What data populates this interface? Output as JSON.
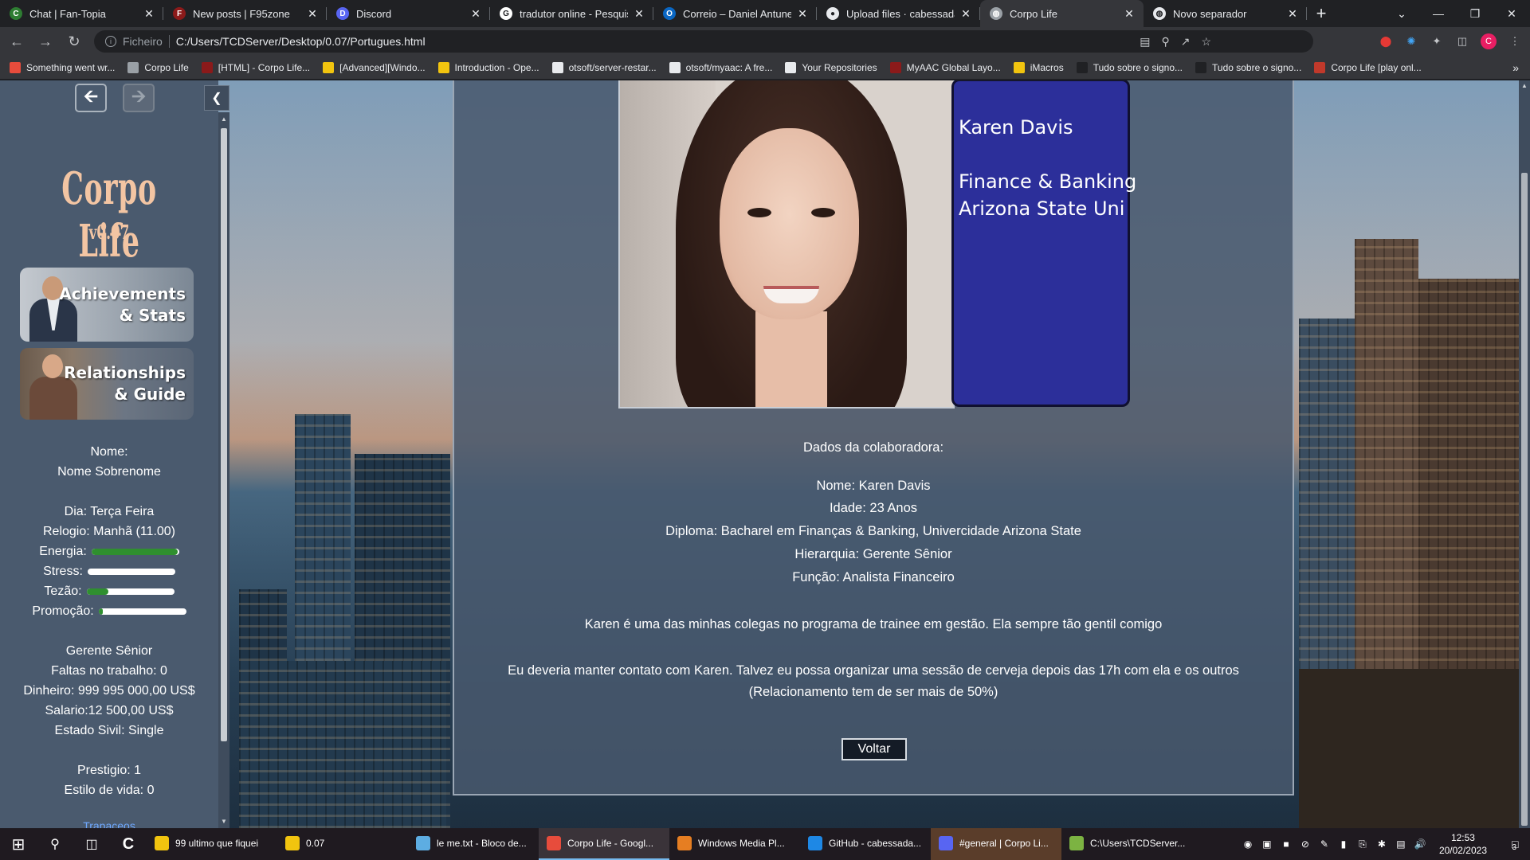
{
  "browser": {
    "tabs": [
      {
        "title": "Chat | Fan-Topia",
        "color": "#2e7d32",
        "glyph": "C"
      },
      {
        "title": "New posts | F95zone",
        "color": "#8b1a1a",
        "glyph": "F"
      },
      {
        "title": "Discord",
        "color": "#5865f2",
        "glyph": "D"
      },
      {
        "title": "tradutor online - Pesquisa",
        "color": "#ffffff",
        "glyph": "G"
      },
      {
        "title": "Correio – Daniel Antunes -",
        "color": "#0a66c2",
        "glyph": "O"
      },
      {
        "title": "Upload files · cabessada/C",
        "color": "#e8eaed",
        "glyph": "●"
      },
      {
        "title": "Corpo Life",
        "color": "#9aa0a6",
        "glyph": "◍"
      },
      {
        "title": "Novo separador",
        "color": "#e8eaed",
        "glyph": "◍"
      }
    ],
    "active_tab_index": 6,
    "address": {
      "scheme": "Ficheiro",
      "url": "C:/Users/TCDServer/Desktop/0.07/Portugues.html"
    },
    "bookmarks": [
      {
        "label": "Something went wr...",
        "color": "#e74c3c"
      },
      {
        "label": "Corpo Life",
        "color": "#9aa0a6"
      },
      {
        "label": "[HTML] - Corpo Life...",
        "color": "#8b1a1a"
      },
      {
        "label": "[Advanced][Windo...",
        "color": "#f1c40f"
      },
      {
        "label": "Introduction - Ope...",
        "color": "#f1c40f"
      },
      {
        "label": "otsoft/server-restar...",
        "color": "#e8eaed"
      },
      {
        "label": "otsoft/myaac: A fre...",
        "color": "#e8eaed"
      },
      {
        "label": "Your Repositories",
        "color": "#e8eaed"
      },
      {
        "label": "MyAAC Global Layo...",
        "color": "#8b1a1a"
      },
      {
        "label": "iMacros",
        "color": "#f1c40f"
      },
      {
        "label": "Tudo sobre o signo...",
        "color": "#202124"
      },
      {
        "label": "Tudo sobre o signo...",
        "color": "#202124"
      },
      {
        "label": "Corpo Life [play onl...",
        "color": "#c0392b"
      }
    ],
    "bookmarks_more": "»",
    "profile_initial": "C"
  },
  "sidebar": {
    "logo_title": "Corpo Life",
    "logo_version": "v0.07",
    "card_achievements": [
      "Achievements",
      "& Stats"
    ],
    "card_relationships": [
      "Relationships",
      "& Guide"
    ],
    "name_label": "Nome:",
    "name_value": "Nome Sobrenome",
    "day": "Dia: Terça Feira",
    "clock": "Relogio: Manhã (11.00)",
    "meters": [
      {
        "label": "Energia:",
        "level": 0.98
      },
      {
        "label": "Stress:",
        "level": 0.0
      },
      {
        "label": "Tezão:",
        "level": 0.25
      },
      {
        "label": "Promoção:",
        "level": 0.05
      }
    ],
    "rank": "Gerente Sênior",
    "absences": "Faltas no trabalho: 0",
    "money": "Dinheiro: 999 995 000,00 US$",
    "salary": "Salario:12 500,00 US$",
    "civil": "Estado Sivil: Single",
    "prestige": "Prestigio: 1",
    "lifestyle": "Estilo de vida: 0",
    "cut_text": "Trapaceos"
  },
  "colleague": {
    "id_name": "Karen Davis",
    "id_line1": "Finance & Banking",
    "id_line2": "Arizona State Uni",
    "heading": "Dados da colaboradora:",
    "nome": "Nome: Karen Davis",
    "idade": "Idade: 23 Anos",
    "diploma": "Diploma: Bacharel em Finanças & Banking, Univercidade Arizona State",
    "hierarquia": "Hierarquia: Gerente Sênior",
    "funcao": "Função: Analista Financeiro",
    "desc1": "Karen é uma das minhas colegas no programa de trainee em gestão. Ela sempre tão gentil comigo",
    "desc2": "Eu deveria manter contato com Karen. Talvez eu possa organizar uma sessão de cerveja depois das 17h com ela e os outros",
    "desc3": "(Relacionamento tem de ser mais de 50%)",
    "back_button": "Voltar"
  },
  "taskbar": {
    "apps": [
      {
        "label": "99 ultimo que fiquei",
        "color": "#f1c40f"
      },
      {
        "label": "0.07",
        "color": "#f1c40f"
      },
      {
        "label": "le me.txt - Bloco de...",
        "color": "#5dade2"
      },
      {
        "label": "Corpo Life - Googl...",
        "color": "#e74c3c"
      },
      {
        "label": "Windows Media Pl...",
        "color": "#e67e22"
      },
      {
        "label": "GitHub - cabessada...",
        "color": "#1e88e5"
      },
      {
        "label": "#general | Corpo Li...",
        "color": "#5865f2"
      },
      {
        "label": "C:\\Users\\TCDServer...",
        "color": "#7cb342"
      }
    ],
    "time": "12:53",
    "date": "20/02/2023",
    "notifications": "3"
  }
}
